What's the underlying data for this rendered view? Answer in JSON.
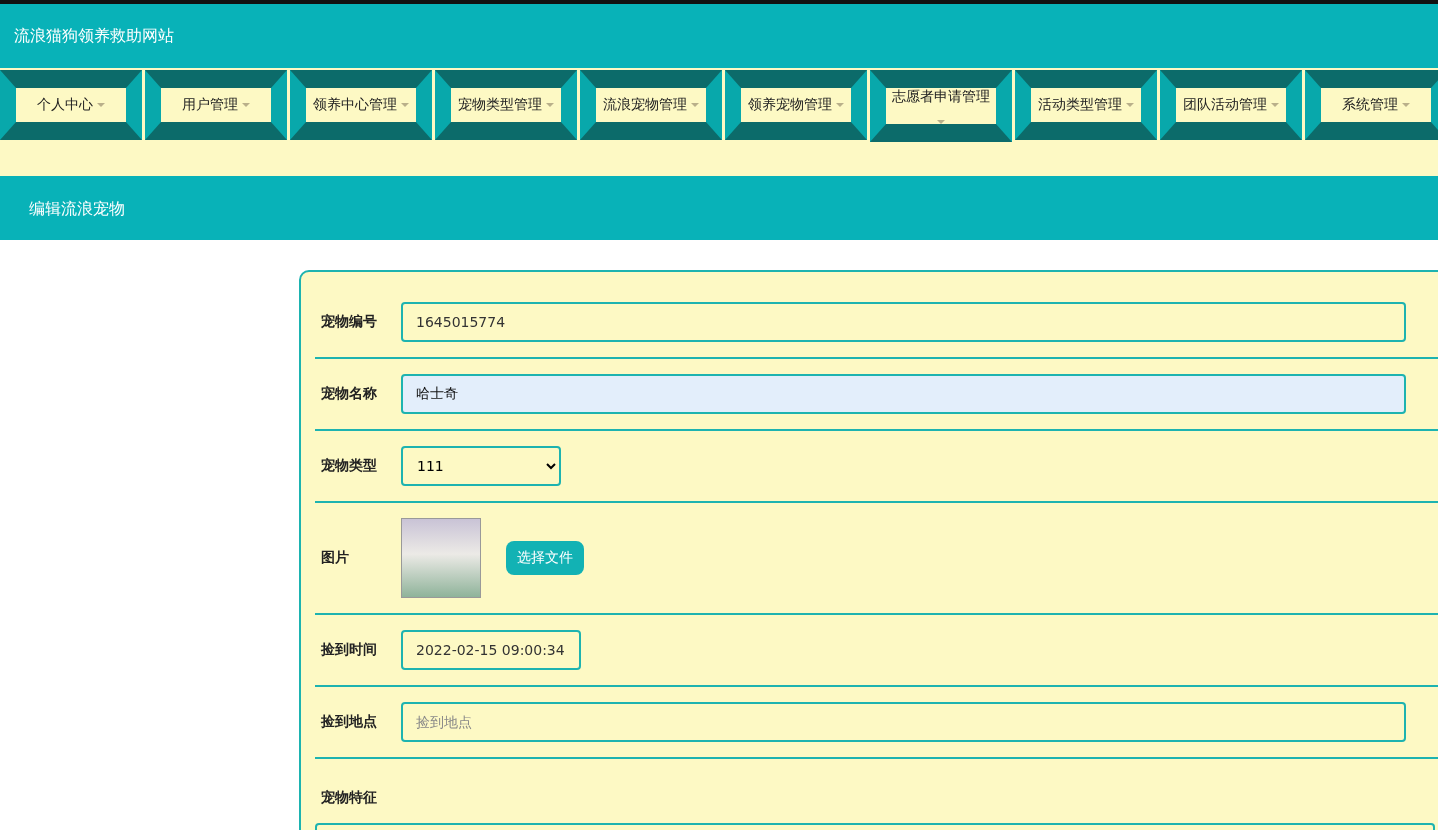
{
  "site_title": "流浪猫狗领养救助网站",
  "nav": [
    {
      "label": "个人中心"
    },
    {
      "label": "用户管理"
    },
    {
      "label": "领养中心管理"
    },
    {
      "label": "宠物类型管理"
    },
    {
      "label": "流浪宠物管理"
    },
    {
      "label": "领养宠物管理"
    },
    {
      "label": "志愿者申请管理"
    },
    {
      "label": "活动类型管理"
    },
    {
      "label": "团队活动管理"
    },
    {
      "label": "系统管理"
    }
  ],
  "page_title": "编辑流浪宠物",
  "form": {
    "fields": [
      {
        "kind": "text",
        "label": "宠物编号",
        "value": "1645015774",
        "autofilled": false
      },
      {
        "kind": "text",
        "label": "宠物名称",
        "value": "哈士奇",
        "autofilled": true
      },
      {
        "kind": "select",
        "label": "宠物类型",
        "value": "111"
      },
      {
        "kind": "image",
        "label": "图片",
        "button": "选择文件"
      },
      {
        "kind": "datetime",
        "label": "捡到时间",
        "value": "2022-02-15 09:00:34"
      },
      {
        "kind": "text",
        "label": "捡到地点",
        "placeholder": "捡到地点",
        "autofilled": false
      },
      {
        "kind": "textarea",
        "label": "宠物特征"
      }
    ]
  }
}
